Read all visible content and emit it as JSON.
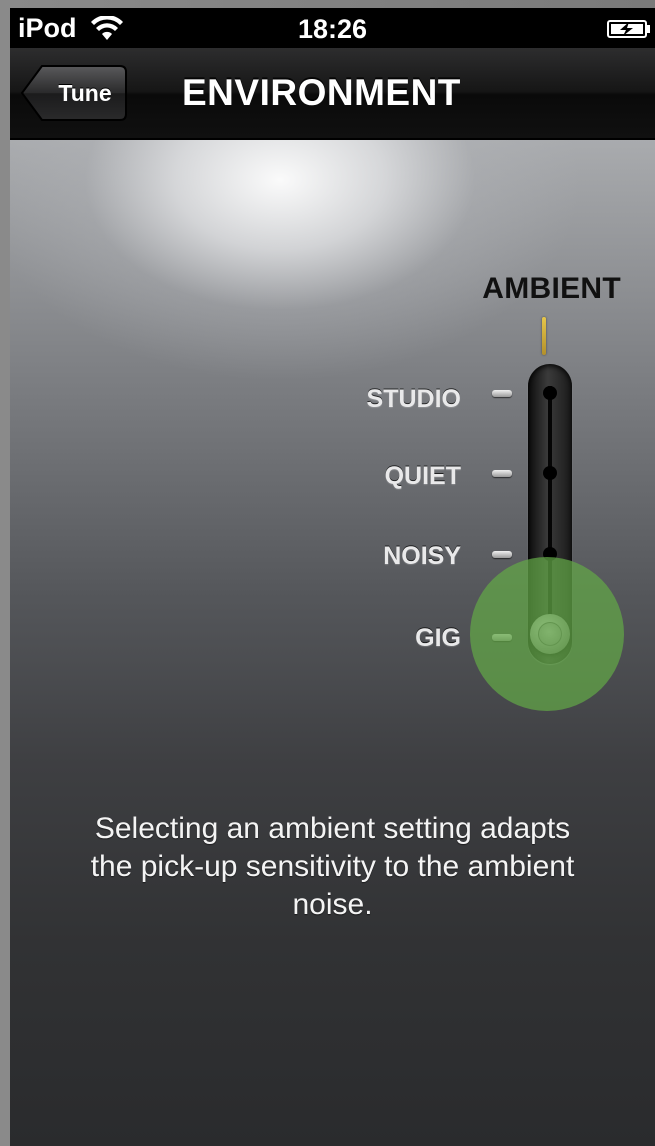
{
  "status_bar": {
    "carrier": "iPod",
    "time": "18:26",
    "wifi_icon": "wifi-icon",
    "battery_icon": "battery-charging-icon"
  },
  "nav": {
    "back_label": "Tune",
    "title": "ENVIRONMENT"
  },
  "selector": {
    "heading": "AMBIENT",
    "options": [
      {
        "label": "STUDIO"
      },
      {
        "label": "QUIET"
      },
      {
        "label": "NOISY"
      },
      {
        "label": "GIG"
      }
    ],
    "selected": "GIG"
  },
  "description": "Selecting an ambient setting adapts the pick-up sensitivity to the ambient noise.",
  "colors": {
    "indicator": "#d4b23c",
    "touch_highlight": "#62a846",
    "text": "#ffffff"
  }
}
